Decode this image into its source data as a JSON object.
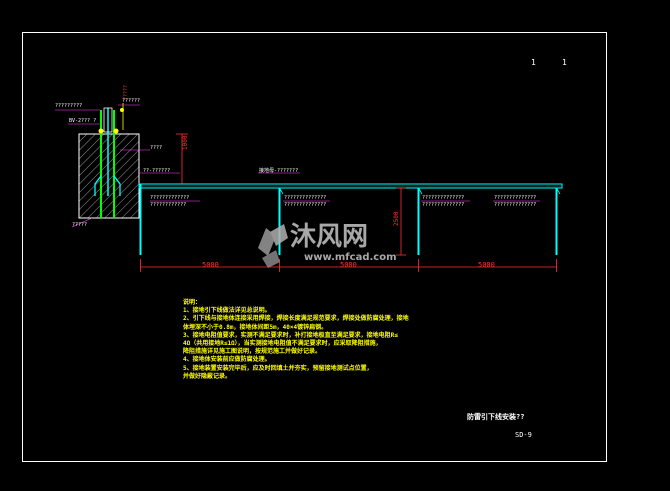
{
  "sheet": {
    "scale_num": "1",
    "scale_den": "1",
    "drawing_title": "防雷引下线安装??",
    "drawing_number": "SD-9"
  },
  "detail": {
    "top_label": "?????????",
    "pipe_label": "??????",
    "wire_label": "BV-2??? ?",
    "elev_label": "?????",
    "depth_label": "1000",
    "side_label": "????",
    "cable_label": "??-??????",
    "base_label": "?????"
  },
  "run": {
    "cable_top_label": "接地母-???????",
    "seg1_label": "?????????????",
    "seg1_sub": "????????????",
    "seg2_label": "??????????????",
    "seg2_sub": "??????????????",
    "seg3_label": "??????????????",
    "seg3_sub": "??????????????",
    "seg4_label": "??????????????",
    "seg4_sub": "??????????????",
    "post_height": "2500",
    "dims": [
      "5000",
      "5000",
      "5000"
    ]
  },
  "notes": {
    "heading": "说明：",
    "lines": [
      "1、接地引下线做法详见总说明。",
      "2、引下线与接地体连接采用焊接，焊接长度满足规范要求，焊接处做防腐处理，接地",
      "   体埋深不小于0.8m，接地体间距5m，40×4镀锌扁钢。",
      "3、接地电阻值要求，实测不满足要求时，补打接地极直至满足要求，接地电阻R≤",
      "   4Ω（共用接地R≤1Ω），当实测接地电阻值不满足要求时，应采取降阻措施，",
      "   降阻措施详见施工图说明，按规范施工并做好记录。",
      "4、接地体安装前应做防腐处理。",
      "5、接地装置安装完毕后，应及时回填土并夯实，预留接地测试点位置，",
      "   并做好隐蔽记录。"
    ]
  },
  "watermark": {
    "brand": "沐风网",
    "url": "www.mfcad.com"
  },
  "colors": {
    "background": "#000000",
    "frame": "#ffffff",
    "conduit": "#00ffff",
    "ground_rod": "#00a0a0",
    "bar": "#00ff00",
    "dimension": "#ff3030",
    "callout": "#ff40ff",
    "notes": "#ffff00"
  }
}
